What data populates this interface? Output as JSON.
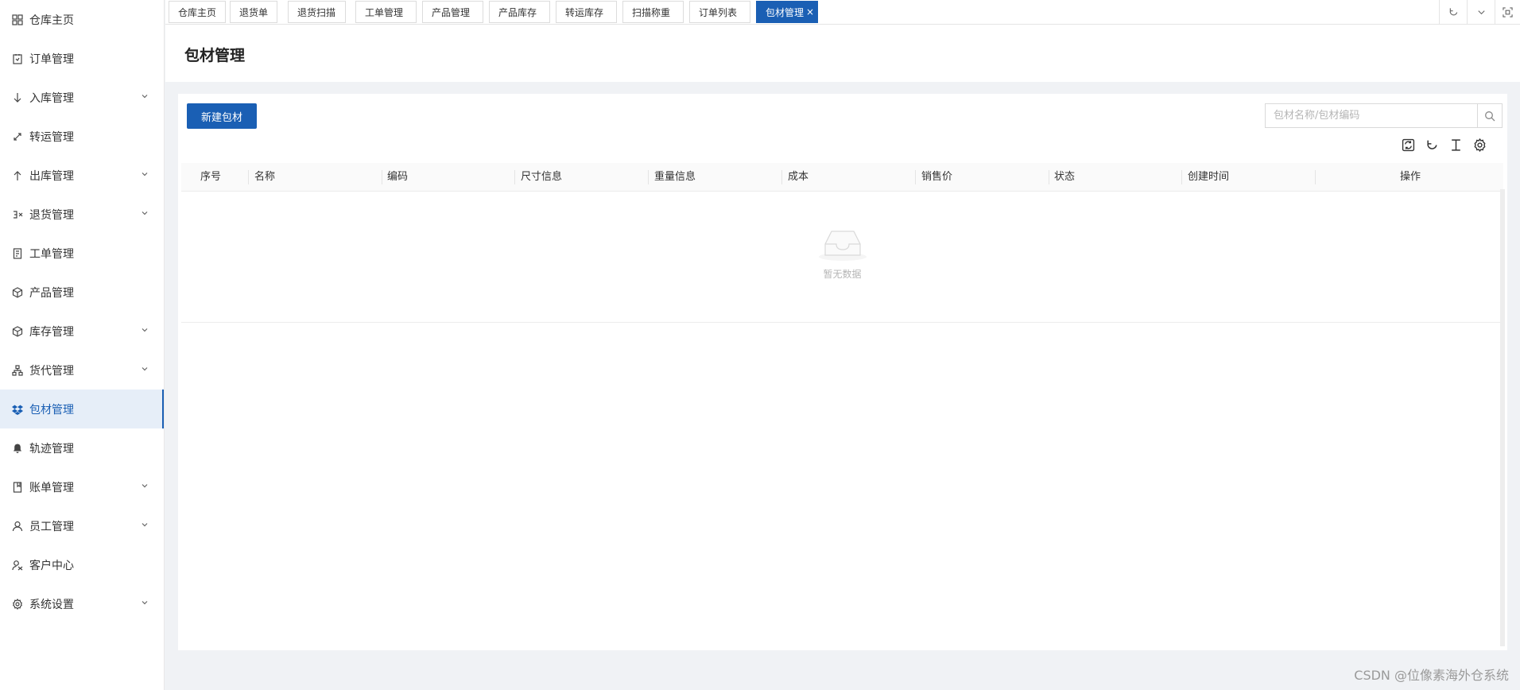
{
  "sidebar": {
    "items": [
      {
        "label": "仓库主页",
        "icon": "dashboard-icon",
        "expandable": false
      },
      {
        "label": "订单管理",
        "icon": "order-icon",
        "expandable": false
      },
      {
        "label": "入库管理",
        "icon": "arrow-down-icon",
        "expandable": true
      },
      {
        "label": "转运管理",
        "icon": "transfer-icon",
        "expandable": false
      },
      {
        "label": "出库管理",
        "icon": "arrow-up-icon",
        "expandable": true
      },
      {
        "label": "退货管理",
        "icon": "return-icon",
        "expandable": true
      },
      {
        "label": "工单管理",
        "icon": "document-icon",
        "expandable": false
      },
      {
        "label": "产品管理",
        "icon": "product-icon",
        "expandable": false
      },
      {
        "label": "库存管理",
        "icon": "box-icon",
        "expandable": true
      },
      {
        "label": "货代管理",
        "icon": "network-icon",
        "expandable": true
      },
      {
        "label": "包材管理",
        "icon": "package-icon",
        "expandable": false,
        "active": true
      },
      {
        "label": "轨迹管理",
        "icon": "bell-icon",
        "expandable": false
      },
      {
        "label": "账单管理",
        "icon": "bill-icon",
        "expandable": true
      },
      {
        "label": "员工管理",
        "icon": "user-icon",
        "expandable": true
      },
      {
        "label": "客户中心",
        "icon": "customer-icon",
        "expandable": false
      },
      {
        "label": "系统设置",
        "icon": "gear-icon",
        "expandable": true
      }
    ]
  },
  "tabs": [
    {
      "label": "仓库主页"
    },
    {
      "label": "退货单"
    },
    {
      "label": "退货扫描"
    },
    {
      "label": "工单管理"
    },
    {
      "label": "产品管理"
    },
    {
      "label": "产品库存"
    },
    {
      "label": "转运库存"
    },
    {
      "label": "扫描称重"
    },
    {
      "label": "订单列表"
    },
    {
      "label": "包材管理",
      "active": true,
      "close": "×"
    }
  ],
  "page": {
    "title": "包材管理"
  },
  "toolbar": {
    "new_button": "新建包材"
  },
  "search": {
    "placeholder": "包材名称/包材编码"
  },
  "table": {
    "columns": [
      "序号",
      "名称",
      "编码",
      "尺寸信息",
      "重量信息",
      "成本",
      "销售价",
      "状态",
      "创建时间",
      "操作"
    ],
    "rows": [],
    "empty_text": "暂无数据"
  },
  "watermark": "CSDN @位像素海外仓系统",
  "colors": {
    "primary": "#1a5fb4",
    "active_bg": "#e6eef8"
  }
}
